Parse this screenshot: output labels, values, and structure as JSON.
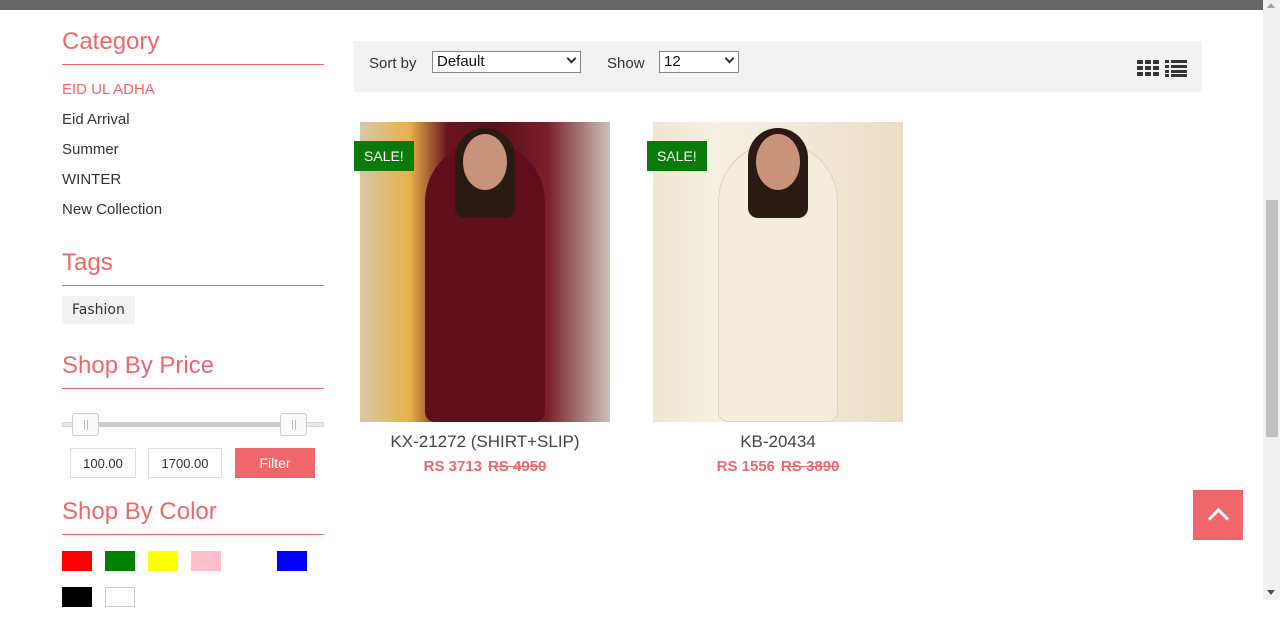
{
  "sidebar": {
    "category_heading": "Category",
    "categories": [
      {
        "label": "EID UL ADHA",
        "active": true
      },
      {
        "label": "Eid Arrival",
        "active": false
      },
      {
        "label": "Summer",
        "active": false
      },
      {
        "label": "WINTER",
        "active": false
      },
      {
        "label": "New Collection",
        "active": false
      }
    ],
    "tags_heading": "Tags",
    "tags": [
      "Fashion"
    ],
    "price_heading": "Shop By Price",
    "price_min": "100.00",
    "price_max": "1700.00",
    "filter_label": "Filter",
    "color_heading": "Shop By Color",
    "colors": [
      "#ff0000",
      "#008000",
      "#ffff00",
      "#ffc0cb",
      "#ffffff",
      "#0000ff",
      "#000000",
      "#ffffff"
    ]
  },
  "toolbar": {
    "sort_label": "Sort by",
    "sort_value": "Default",
    "show_label": "Show",
    "show_value": "12"
  },
  "products": [
    {
      "name": "KX-21272 (SHIRT+SLIP)",
      "badge": "SALE!",
      "price": "RS 3713",
      "old_price": "RS 4950"
    },
    {
      "name": "KB-20434",
      "badge": "SALE!",
      "price": "RS 1556",
      "old_price": "RS 3890"
    }
  ],
  "colors": {
    "accent": "#f0676b",
    "sale": "#0a7a0a",
    "toolbar_bg": "#f2f2f2"
  }
}
